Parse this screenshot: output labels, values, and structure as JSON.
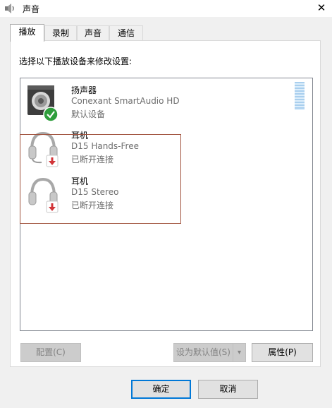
{
  "window": {
    "title": "声音",
    "close_glyph": "✕"
  },
  "tabs": [
    {
      "label": "播放",
      "selected": true
    },
    {
      "label": "录制",
      "selected": false
    },
    {
      "label": "声音",
      "selected": false
    },
    {
      "label": "通信",
      "selected": false
    }
  ],
  "instruction": "选择以下播放设备来修改设置:",
  "devices": [
    {
      "name": "扬声器",
      "driver": "Conexant SmartAudio HD",
      "status": "默认设备",
      "icon": "speaker-icon",
      "badge": "default-check-badge"
    },
    {
      "name": "耳机",
      "driver": "D15 Hands-Free",
      "status": "已断开连接",
      "icon": "headset-icon",
      "badge": "disconnected-badge"
    },
    {
      "name": "耳机",
      "driver": "D15 Stereo",
      "status": "已断开连接",
      "icon": "headphones-icon",
      "badge": "disconnected-badge"
    }
  ],
  "buttons": {
    "configure": "配置(C)",
    "set_default": "设为默认值(S)",
    "set_default_arrow": "▾",
    "properties": "属性(P)",
    "ok": "确定",
    "cancel": "取消"
  },
  "colors": {
    "accent": "#0078d7",
    "check_badge": "#2e9e3c",
    "disconnect_badge": "#d13438",
    "highlight_border": "#a0523d"
  }
}
